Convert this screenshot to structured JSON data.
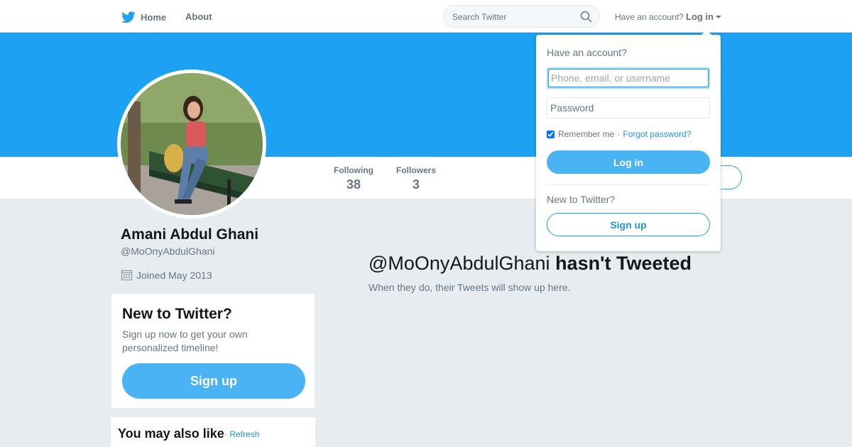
{
  "nav": {
    "home_label": "Home",
    "about_label": "About",
    "search_placeholder": "Search Twitter",
    "have_account": "Have an account?",
    "login_label": "Log in"
  },
  "profile": {
    "full_name": "Amani Abdul Ghani",
    "handle": "@MoOnyAbdulGhani",
    "joined": "Joined May 2013",
    "stats": [
      {
        "label": "Following",
        "value": "38"
      },
      {
        "label": "Followers",
        "value": "3"
      }
    ]
  },
  "signup_module": {
    "title": "New to Twitter?",
    "text": "Sign up now to get your own personalized timeline!",
    "button": "Sign up"
  },
  "who_to_follow": {
    "title": "You may also like",
    "separator": " · ",
    "refresh": "Refresh"
  },
  "timeline_empty": {
    "handle": "@MoOnyAbdulGhani",
    "title_rest": "hasn't Tweeted",
    "subtitle": "When they do, their Tweets will show up here."
  },
  "login_dropdown": {
    "title": "Have an account?",
    "username_placeholder": "Phone, email, or username",
    "password_placeholder": "Password",
    "remember_me": "Remember me",
    "separator": "·",
    "forgot_password": "Forgot password?",
    "login_button": "Log in",
    "new_to_twitter": "New to Twitter?",
    "signup_button": "Sign up",
    "remember_checked": true
  },
  "colors": {
    "brand_blue": "#1da1f2",
    "button_blue": "#4ab3f4",
    "link_blue": "#1b95e0",
    "page_bg": "#e6ecf0"
  },
  "icons": [
    "twitter-bird-icon",
    "search-icon",
    "calendar-icon",
    "chevron-down-icon"
  ]
}
